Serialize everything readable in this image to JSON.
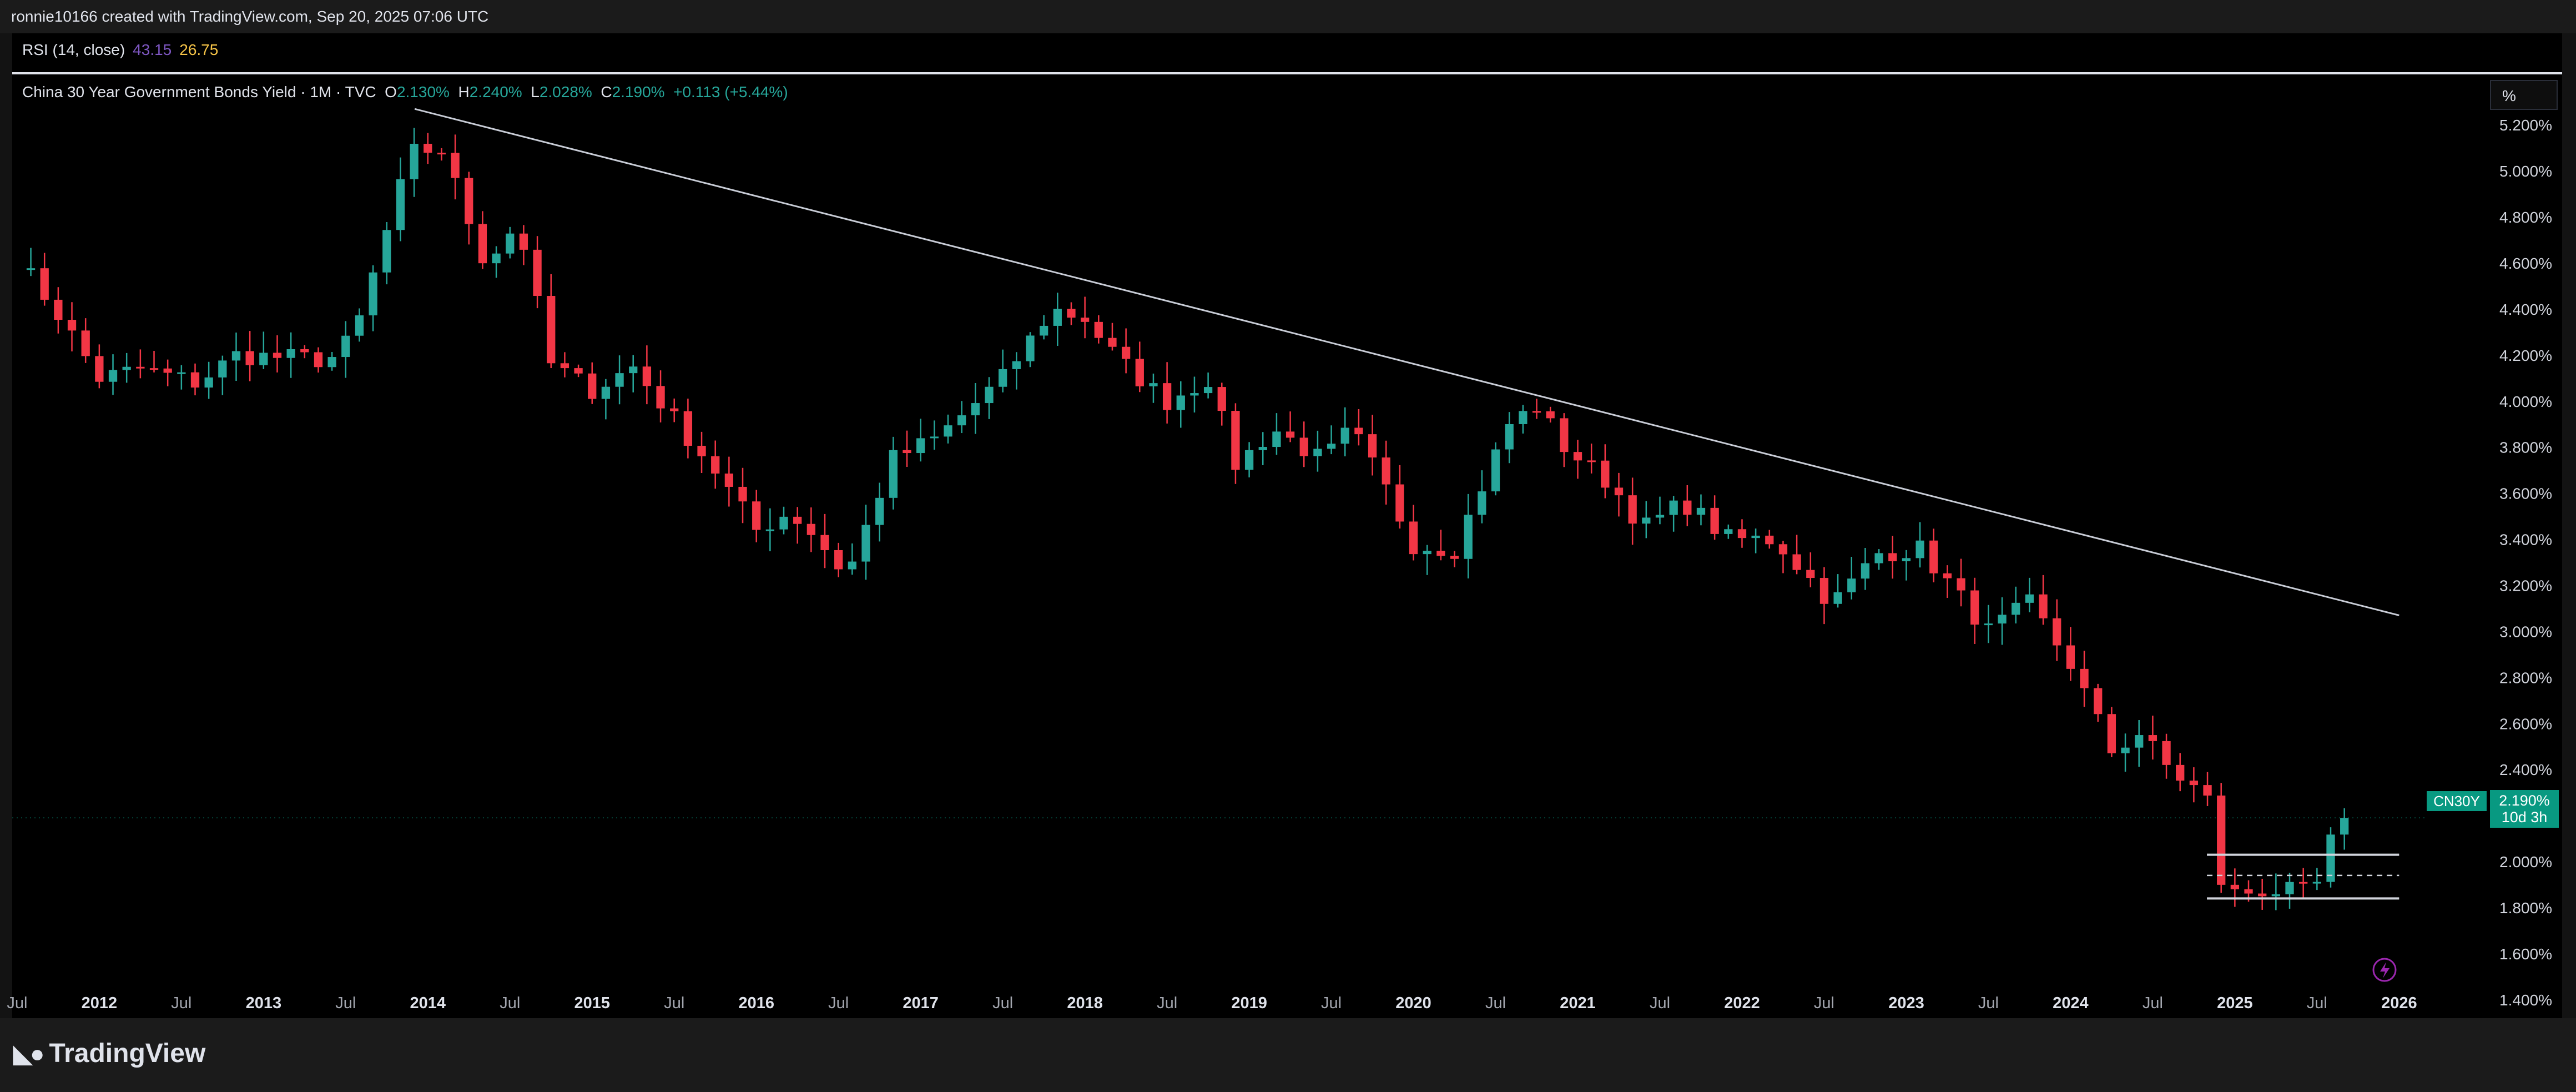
{
  "header": {
    "caption": "ronnie10166 created with TradingView.com, Sep 20, 2025 07:06 UTC"
  },
  "rsi": {
    "label": "RSI (14, close)",
    "value1": "43.15",
    "value2": "26.75"
  },
  "legend": {
    "title": "China 30 Year Government Bonds Yield · 1M · TVC",
    "o_label": "O",
    "o_value": "2.130%",
    "h_label": "H",
    "h_value": "2.240%",
    "l_label": "L",
    "l_value": "2.028%",
    "c_label": "C",
    "c_value": "2.190%",
    "change": "+0.113 (+5.44%)"
  },
  "scale_button": "%",
  "price_tag": {
    "symbol": "CN30Y",
    "price": "2.190%",
    "countdown": "10d 3h"
  },
  "brand": {
    "name": "TradingView"
  },
  "colors": {
    "up": "#26a69a",
    "down": "#f23645",
    "background": "#000000",
    "text": "#d1d4dc"
  },
  "chart_data": {
    "type": "candlestick",
    "title": "China 30 Year Government Bonds Yield · 1M · TVC",
    "y_tick_labels": [
      "5.200%",
      "5.000%",
      "4.800%",
      "4.600%",
      "4.400%",
      "4.200%",
      "4.000%",
      "3.800%",
      "3.600%",
      "3.400%",
      "3.200%",
      "3.000%",
      "2.800%",
      "2.600%",
      "2.400%",
      "2.200%",
      "2.000%",
      "1.800%",
      "1.600%",
      "1.400%"
    ],
    "y_ticks": [
      5.2,
      5.0,
      4.8,
      4.6,
      4.4,
      4.2,
      4.0,
      3.8,
      3.6,
      3.4,
      3.2,
      3.0,
      2.8,
      2.6,
      2.4,
      2.2,
      2.0,
      1.8,
      1.6,
      1.4
    ],
    "ylim": [
      1.32,
      5.42
    ],
    "x_range": [
      2011.47,
      2026.33
    ],
    "x_tick_labels": [
      "Jul",
      "2012",
      "Jul",
      "2013",
      "Jul",
      "2014",
      "Jul",
      "2015",
      "Jul",
      "2016",
      "Jul",
      "2017",
      "Jul",
      "2018",
      "Jul",
      "2019",
      "Jul",
      "2020",
      "Jul",
      "2021",
      "Jul",
      "2022",
      "Jul",
      "2023",
      "Jul",
      "2024",
      "Jul",
      "2025",
      "Jul",
      "2026"
    ],
    "x_ticks": [
      2011.5,
      2012,
      2012.5,
      2013,
      2013.5,
      2014,
      2014.5,
      2015,
      2015.5,
      2016,
      2016.5,
      2017,
      2017.5,
      2018,
      2018.5,
      2019,
      2019.5,
      2020,
      2020.5,
      2021,
      2021.5,
      2022,
      2022.5,
      2023,
      2023.5,
      2024,
      2024.5,
      2025,
      2025.5,
      2026
    ],
    "last_price": 2.19,
    "yield_knots": [
      [
        2011.5,
        4.62
      ],
      [
        2011.75,
        4.38
      ],
      [
        2012.0,
        4.1
      ],
      [
        2012.25,
        4.14
      ],
      [
        2012.6,
        4.08
      ],
      [
        2012.83,
        4.2
      ],
      [
        2013.4,
        4.18
      ],
      [
        2013.55,
        4.28
      ],
      [
        2013.9,
        5.08
      ],
      [
        2014.08,
        5.1
      ],
      [
        2014.35,
        4.6
      ],
      [
        2014.55,
        4.78
      ],
      [
        2014.75,
        4.16
      ],
      [
        2015.0,
        4.05
      ],
      [
        2015.25,
        4.15
      ],
      [
        2015.5,
        3.92
      ],
      [
        2015.75,
        3.7
      ],
      [
        2016.0,
        3.44
      ],
      [
        2016.2,
        3.52
      ],
      [
        2016.35,
        3.42
      ],
      [
        2016.55,
        3.24
      ],
      [
        2016.83,
        3.75
      ],
      [
        2017.1,
        3.84
      ],
      [
        2017.5,
        4.1
      ],
      [
        2017.8,
        4.4
      ],
      [
        2018.0,
        4.36
      ],
      [
        2018.2,
        4.18
      ],
      [
        2018.5,
        4.0
      ],
      [
        2018.75,
        4.1
      ],
      [
        2018.92,
        3.72
      ],
      [
        2019.15,
        3.88
      ],
      [
        2019.45,
        3.74
      ],
      [
        2019.62,
        3.88
      ],
      [
        2019.83,
        3.62
      ],
      [
        2020.0,
        3.38
      ],
      [
        2020.25,
        3.36
      ],
      [
        2020.58,
        3.9
      ],
      [
        2020.75,
        3.98
      ],
      [
        2020.92,
        3.8
      ],
      [
        2021.2,
        3.64
      ],
      [
        2021.4,
        3.45
      ],
      [
        2021.65,
        3.56
      ],
      [
        2021.92,
        3.4
      ],
      [
        2022.2,
        3.4
      ],
      [
        2022.55,
        3.12
      ],
      [
        2022.83,
        3.34
      ],
      [
        2023.08,
        3.36
      ],
      [
        2023.5,
        3.0
      ],
      [
        2023.75,
        3.12
      ],
      [
        2024.0,
        2.86
      ],
      [
        2024.25,
        2.48
      ],
      [
        2024.42,
        2.56
      ],
      [
        2024.6,
        2.4
      ],
      [
        2024.83,
        2.28
      ],
      [
        2024.92,
        1.9
      ],
      [
        2025.0,
        1.86
      ],
      [
        2025.2,
        1.88
      ],
      [
        2025.42,
        1.86
      ],
      [
        2025.5,
        1.9
      ],
      [
        2025.58,
        2.08
      ],
      [
        2025.67,
        2.19
      ]
    ],
    "trendline": {
      "x": [
        2013.92,
        2026.0
      ],
      "y": [
        5.27,
        3.07
      ]
    },
    "range_box": {
      "x": [
        2024.83,
        2026.0
      ],
      "upper": 2.03,
      "mid": 1.94,
      "lower": 1.84
    }
  }
}
